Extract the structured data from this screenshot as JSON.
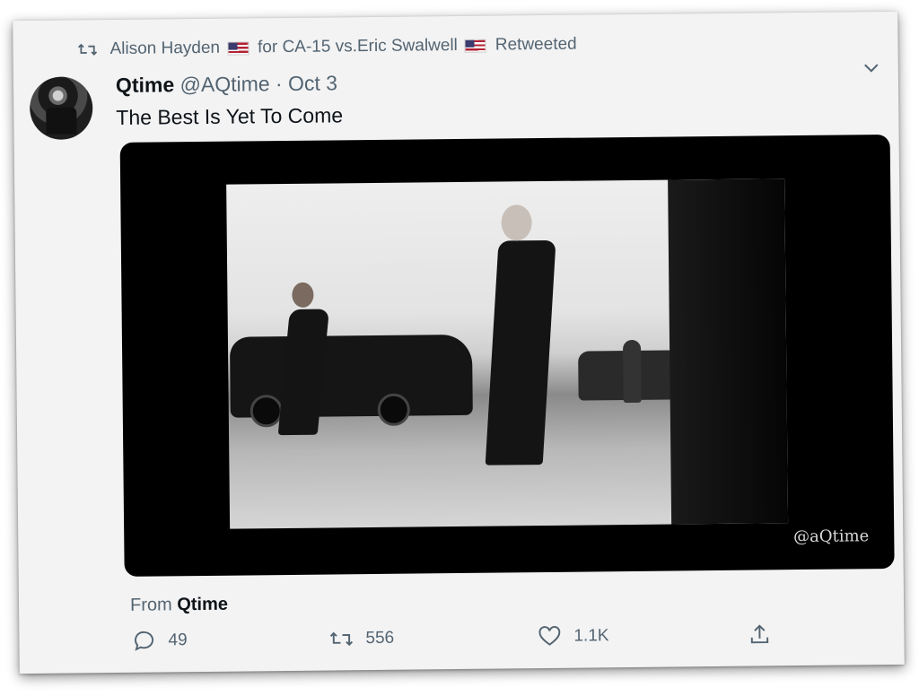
{
  "retweet_header": {
    "retweeter": "Alison Hayden",
    "retweeter_suffix": "for CA-15 vs.Eric Swalwell",
    "action": "Retweeted"
  },
  "tweet": {
    "display_name": "Qtime",
    "handle": "@AQtime",
    "separator": "·",
    "date": "Oct 3",
    "text": "The Best Is Yet To Come",
    "media_watermark": "@aQtime",
    "from_label": "From",
    "from_name": "Qtime"
  },
  "stats": {
    "replies": "49",
    "retweets": "556",
    "likes": "1.1K"
  },
  "icons": {
    "retweet_header": "retweet-icon",
    "more": "chevron-down-icon",
    "reply": "reply-icon",
    "retweet": "retweet-icon",
    "like": "heart-icon",
    "share": "share-icon"
  },
  "colors": {
    "secondary_text": "#536471",
    "primary_text": "#0f1419",
    "card_bg": "#f3f3f4"
  }
}
